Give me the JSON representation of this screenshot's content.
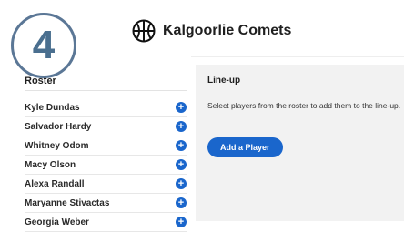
{
  "step": {
    "number": "4"
  },
  "header": {
    "team_name": "Kalgoorlie Comets",
    "icon": "basketball-icon"
  },
  "roster": {
    "title": "Roster",
    "players": [
      "Kyle Dundas",
      "Salvador Hardy",
      "Whitney Odom",
      "Macy Olson",
      "Alexa Randall",
      "Maryanne Stivactas",
      "Georgia Weber"
    ],
    "add_icon": "plus-circle-icon"
  },
  "lineup": {
    "title": "Line-up",
    "help_text": "Select players from the roster to add them to the line-up.",
    "add_button_label": "Add a Player"
  },
  "colors": {
    "accent": "#1a66cc",
    "badge": "#4a6f8f",
    "panel": "#f2f2f2"
  }
}
